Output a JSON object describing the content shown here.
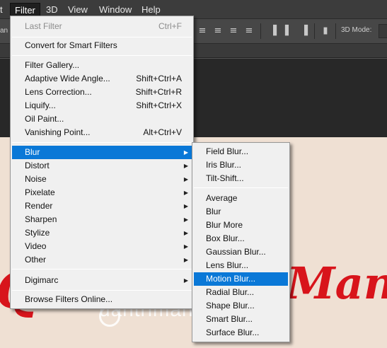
{
  "menubar": {
    "left_stub": "t",
    "items": [
      {
        "label": "Filter"
      },
      {
        "label": "3D"
      },
      {
        "label": "View"
      },
      {
        "label": "Window"
      },
      {
        "label": "Help"
      }
    ]
  },
  "optbar": {
    "left_label": "an",
    "mode_label": "3D Mode:"
  },
  "filter_menu": {
    "items": [
      {
        "label": "Last Filter",
        "shortcut": "Ctrl+F"
      },
      {
        "label": "Convert for Smart Filters"
      },
      {
        "label": "Filter Gallery..."
      },
      {
        "label": "Adaptive Wide Angle...",
        "shortcut": "Shift+Ctrl+A"
      },
      {
        "label": "Lens Correction...",
        "shortcut": "Shift+Ctrl+R"
      },
      {
        "label": "Liquify...",
        "shortcut": "Shift+Ctrl+X"
      },
      {
        "label": "Oil Paint..."
      },
      {
        "label": "Vanishing Point...",
        "shortcut": "Alt+Ctrl+V"
      },
      {
        "label": "Blur"
      },
      {
        "label": "Distort"
      },
      {
        "label": "Noise"
      },
      {
        "label": "Pixelate"
      },
      {
        "label": "Render"
      },
      {
        "label": "Sharpen"
      },
      {
        "label": "Stylize"
      },
      {
        "label": "Video"
      },
      {
        "label": "Other"
      },
      {
        "label": "Digimarc"
      },
      {
        "label": "Browse Filters Online..."
      }
    ]
  },
  "blur_menu": {
    "items": [
      {
        "label": "Field Blur..."
      },
      {
        "label": "Iris Blur..."
      },
      {
        "label": "Tilt-Shift..."
      },
      {
        "label": "Average"
      },
      {
        "label": "Blur"
      },
      {
        "label": "Blur More"
      },
      {
        "label": "Box Blur..."
      },
      {
        "label": "Gaussian Blur..."
      },
      {
        "label": "Lens Blur..."
      },
      {
        "label": "Motion Blur..."
      },
      {
        "label": "Radial Blur..."
      },
      {
        "label": "Shape Blur..."
      },
      {
        "label": "Smart Blur..."
      },
      {
        "label": "Surface Blur..."
      }
    ]
  },
  "canvas": {
    "watermark_text": "uantrimang",
    "deco_left": "Q",
    "deco_right": "Mang"
  },
  "colors": {
    "menu_highlight": "#0a78d7",
    "canvas_bg": "#efe0d3",
    "deco_red": "#d8141b"
  }
}
